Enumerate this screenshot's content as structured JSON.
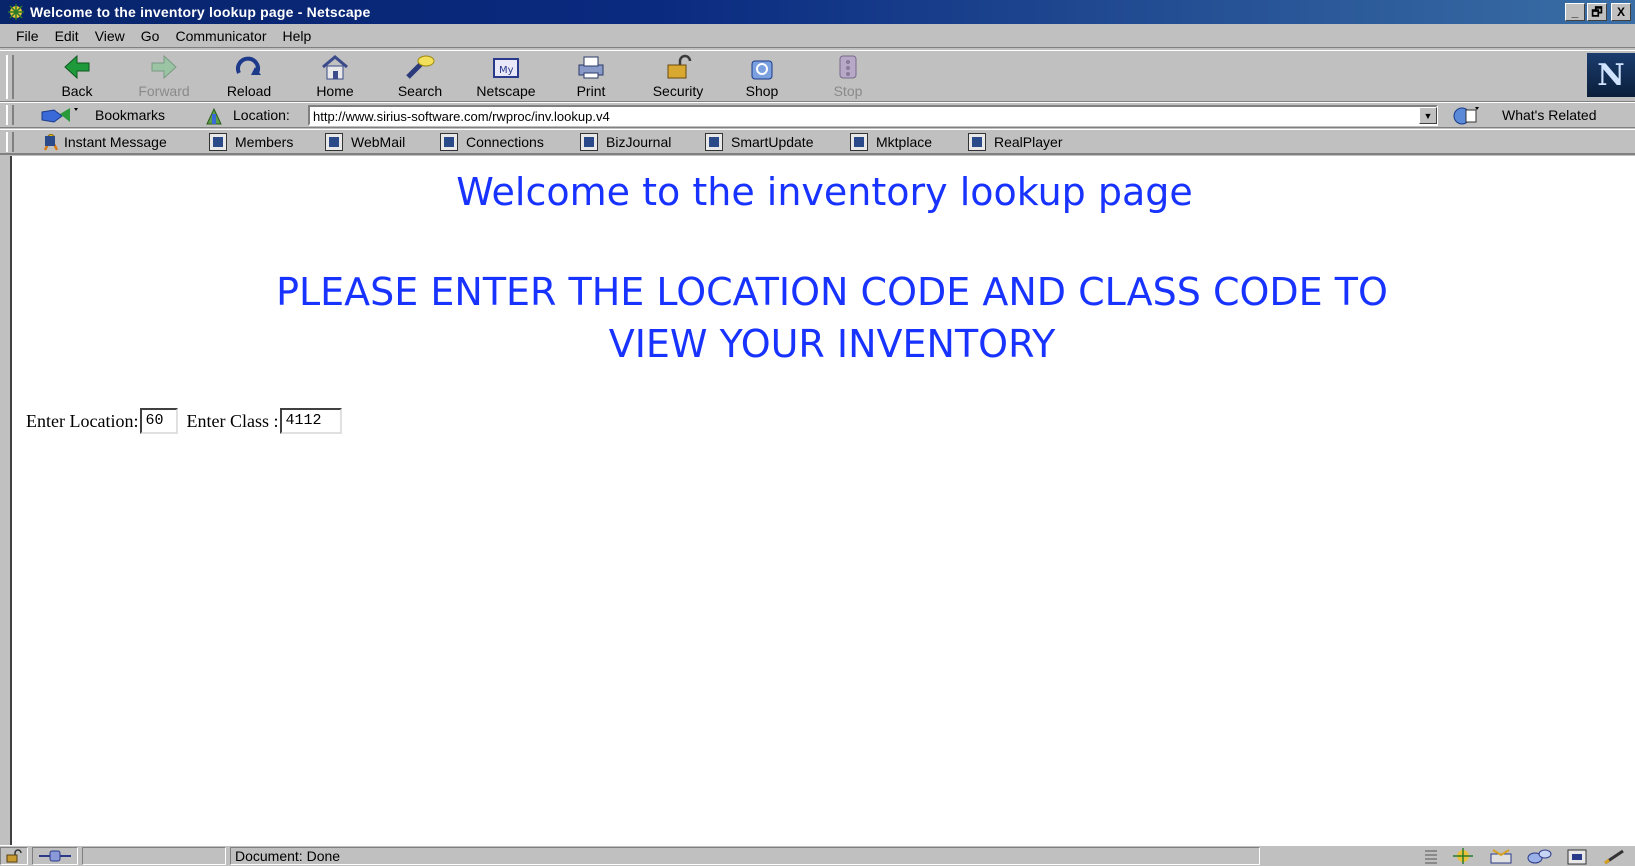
{
  "window": {
    "title": "Welcome to the inventory lookup page - Netscape",
    "minimize": "_",
    "restore": "🗗",
    "close": "X"
  },
  "menu": [
    "File",
    "Edit",
    "View",
    "Go",
    "Communicator",
    "Help"
  ],
  "toolbar": {
    "back": "Back",
    "forward": "Forward",
    "reload": "Reload",
    "home": "Home",
    "search": "Search",
    "netscape": "Netscape",
    "print": "Print",
    "security": "Security",
    "shop": "Shop",
    "stop": "Stop",
    "logo": "N"
  },
  "location_bar": {
    "bookmarks": "Bookmarks",
    "location_label": "Location:",
    "url": "http://www.sirius-software.com/rwproc/inv.lookup.v4",
    "whats_related": "What's Related"
  },
  "personal_toolbar": [
    "Instant Message",
    "Members",
    "WebMail",
    "Connections",
    "BizJournal",
    "SmartUpdate",
    "Mktplace",
    "RealPlayer"
  ],
  "page": {
    "title": "Welcome to the inventory lookup page",
    "instruction_line1": "PLEASE ENTER THE LOCATION CODE AND CLASS CODE TO",
    "instruction_line2": "VIEW YOUR INVENTORY",
    "location_label": "Enter Location:",
    "location_value": "60",
    "class_label": "Enter Class :",
    "class_value": "4112"
  },
  "status": {
    "text": "Document: Done"
  },
  "colors": {
    "heading": "#1833ff",
    "titlebar": "#08246b",
    "chrome": "#c0c0c0"
  }
}
